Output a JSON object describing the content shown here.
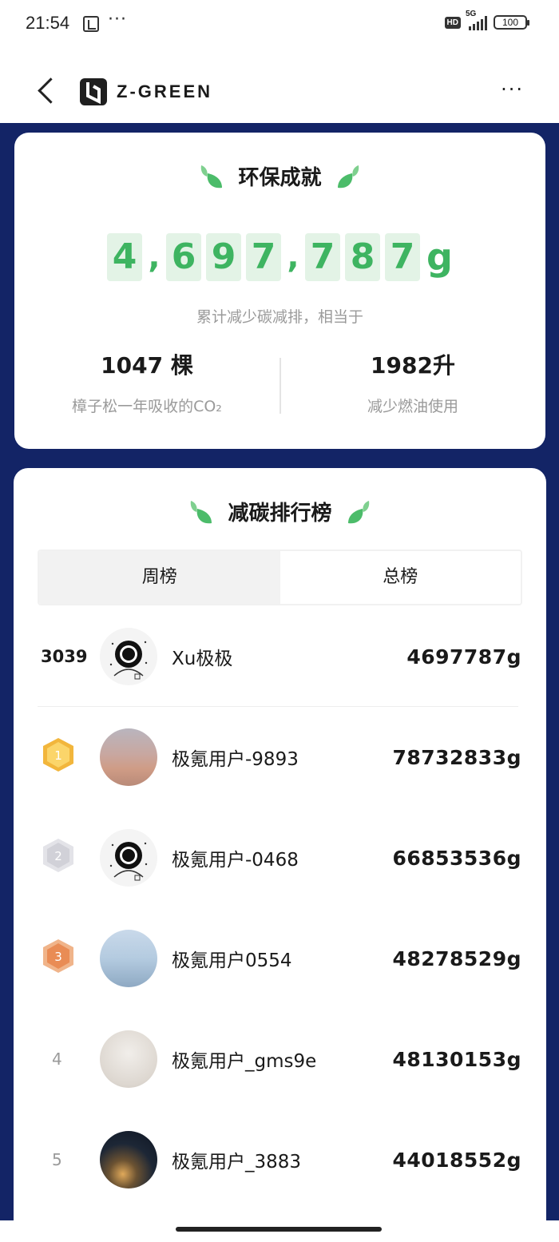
{
  "status_bar": {
    "time": "21:54",
    "dots": "···",
    "hd": "HD",
    "network": "5G",
    "battery": "100"
  },
  "header": {
    "brand": "Z-GREEN"
  },
  "achievement": {
    "title": "环保成就",
    "digits": [
      "4",
      ",",
      "6",
      "9",
      "7",
      ",",
      "7",
      "8",
      "7"
    ],
    "unit": "g",
    "subtitle": "累计减少碳减排，相当于",
    "stats": [
      {
        "value": "1047 棵",
        "label": "樟子松一年吸收的CO₂"
      },
      {
        "value": "1982升",
        "label": "减少燃油使用"
      }
    ]
  },
  "leaderboard": {
    "title": "减碳排行榜",
    "tabs": {
      "weekly": "周榜",
      "total": "总榜"
    },
    "own": {
      "rank": "3039",
      "name": "Xu极极",
      "score": "4697787g"
    },
    "rows": [
      {
        "rank": "1",
        "name": "极氪用户-9893",
        "score": "78732833g"
      },
      {
        "rank": "2",
        "name": "极氪用户-0468",
        "score": "66853536g"
      },
      {
        "rank": "3",
        "name": "极氪用户0554",
        "score": "48278529g"
      },
      {
        "rank": "4",
        "name": "极氪用户_gms9e",
        "score": "48130153g"
      },
      {
        "rank": "5",
        "name": "极氪用户_3883",
        "score": "44018552g"
      }
    ]
  },
  "colors": {
    "accent_green": "#3eb461",
    "navy": "#132466",
    "gold": "#f2b63c",
    "silver": "#d9d9de",
    "bronze": "#e98c55"
  }
}
